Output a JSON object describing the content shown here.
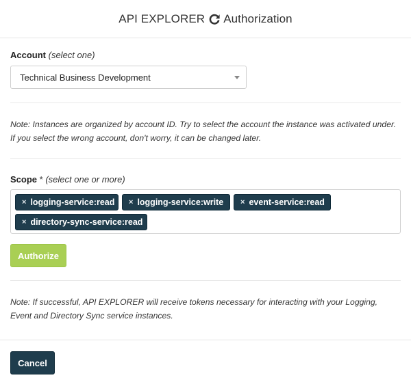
{
  "header": {
    "brand": "API EXPLORER",
    "icon": "refresh-icon",
    "title": "Authorization"
  },
  "account": {
    "label": "Account",
    "hint": "(select one)",
    "selected": "Technical Business Development"
  },
  "notes": {
    "instances": "Note: Instances are organized by account ID. Try to select the account the instance was activated under. If you select the wrong account, don't worry, it can be changed later.",
    "success": "Note: If successful, API EXPLORER will receive tokens necessary for interacting with your Logging, Event and Directory Sync service instances."
  },
  "scope": {
    "label": "Scope",
    "required": "*",
    "hint": "(select one or more)",
    "tags": [
      "logging-service:read",
      "logging-service:write",
      "event-service:read",
      "directory-sync-service:read"
    ],
    "remove_glyph": "×"
  },
  "buttons": {
    "authorize": "Authorize",
    "cancel": "Cancel"
  },
  "colors": {
    "tag_bg": "#1f3d4d",
    "authorize_bg": "#a9cf54",
    "cancel_bg": "#1f3d4d"
  }
}
